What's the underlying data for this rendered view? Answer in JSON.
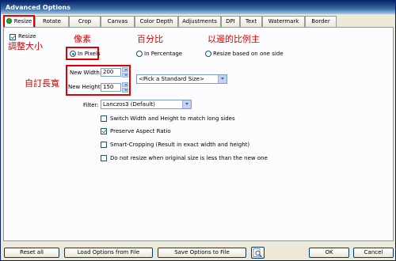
{
  "window": {
    "title": "Advanced Options"
  },
  "tabs": [
    "Resize",
    "Rotate",
    "Crop",
    "Canvas",
    "Color Depth",
    "Adjustments",
    "DPI",
    "Text",
    "Watermark",
    "Border"
  ],
  "resize": {
    "enable_label": "Resize",
    "enabled": true,
    "mode_pixels": "In Pixels",
    "mode_percentage": "In Percentage",
    "mode_one_side": "Resize based on one side",
    "width_label": "New Width:",
    "width_value": "200",
    "height_label": "New Height:",
    "height_value": "150",
    "standard_size": "<Pick a Standard Size>",
    "filter_label": "Filter:",
    "filter_value": "Lanczos3 (Default)",
    "options": [
      {
        "label": "Switch Width and Height to match long sides",
        "checked": false
      },
      {
        "label": "Preserve Aspect Ratio",
        "checked": true
      },
      {
        "label": "Smart-Cropping (Result in exact width and height)",
        "checked": false
      },
      {
        "label": "Do not resize when original size is less than the new one",
        "checked": false
      }
    ]
  },
  "annotations": {
    "resize": "調整大小",
    "pixels": "像素",
    "percentage": "百分比",
    "one_side": "以邊的比例主",
    "custom": "自訂長寬"
  },
  "footer": {
    "reset": "Reset all",
    "load": "Load Options from File",
    "save": "Save Options to File",
    "ok": "OK",
    "cancel": "Cancel"
  },
  "colors": {
    "title_bar": "#0a246a",
    "annotation_red": "#e00000",
    "panel_bg": "#fcfcfe",
    "dialog_bg": "#ece9d8"
  }
}
